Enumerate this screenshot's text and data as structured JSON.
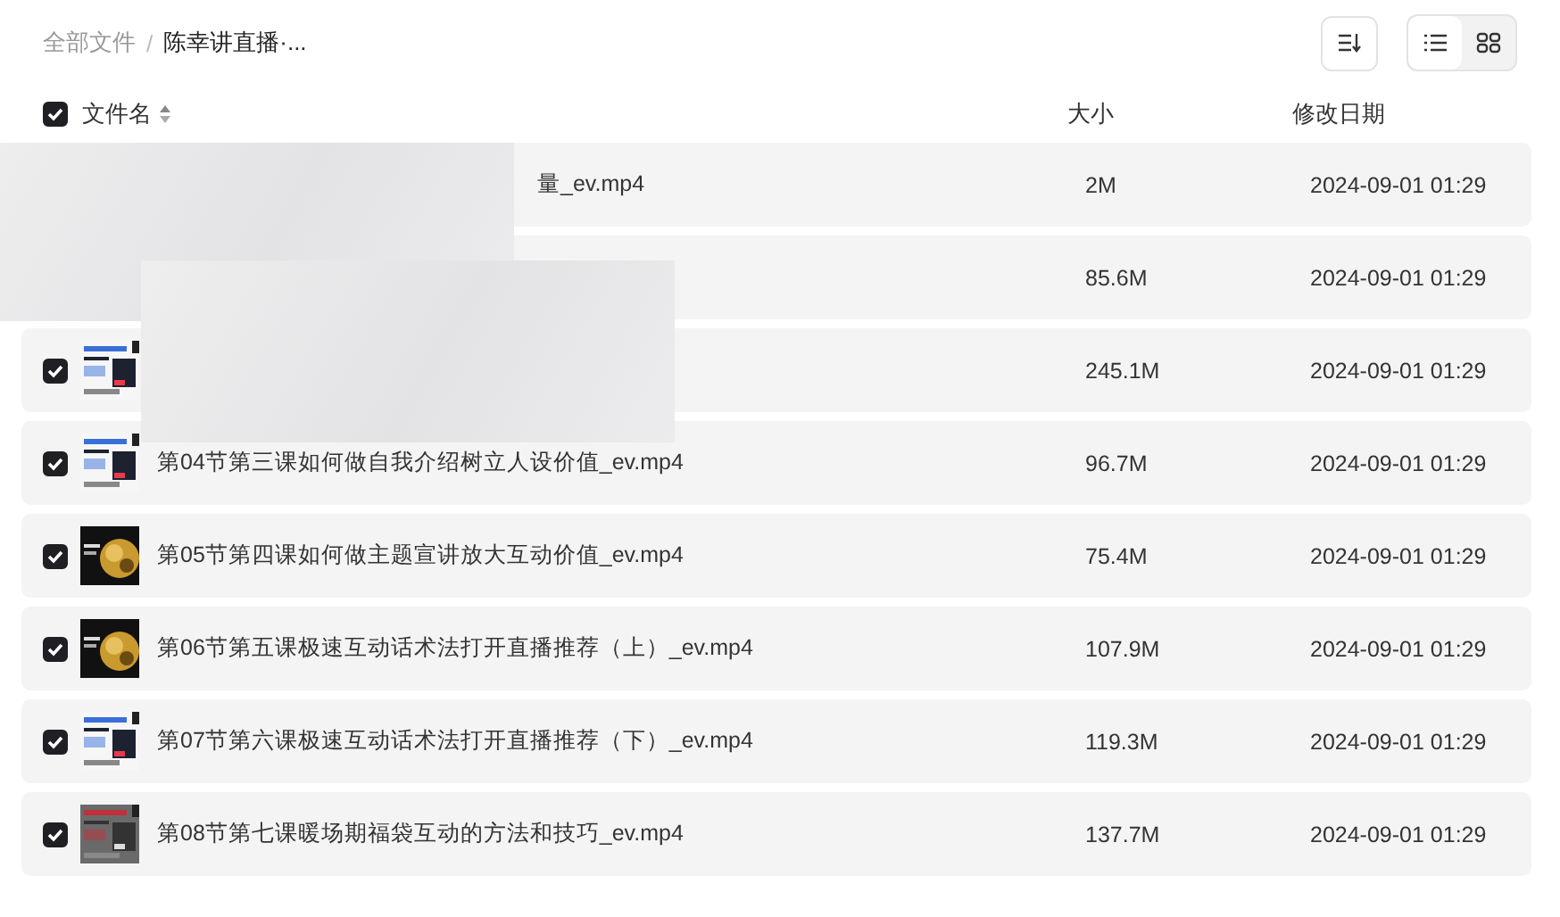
{
  "breadcrumb": [
    {
      "label": "全部文件",
      "current": false
    },
    {
      "label": "陈幸讲直播·...",
      "current": true
    }
  ],
  "breadcrumb_separator": "/",
  "toolbar": {
    "buttons": [
      {
        "kind": "sort"
      }
    ],
    "view_modes": [
      {
        "kind": "list",
        "selected": true
      },
      {
        "kind": "grid",
        "selected": false
      }
    ]
  },
  "table": {
    "select_all": {
      "checked": true
    },
    "columns": [
      {
        "label": "文件名",
        "sortable": true
      },
      {
        "label": "大小",
        "sortable": false
      },
      {
        "label": "修改日期",
        "sortable": false
      }
    ],
    "rows": [
      {
        "kind": "covered",
        "name": "量_ev.mp4",
        "size": "2M",
        "modified": "2024-09-01 01:29"
      },
      {
        "kind": "covered",
        "size": "85.6M",
        "modified": "2024-09-01 01:29"
      },
      {
        "kind": "normal",
        "checked": true,
        "size": "245.1M",
        "modified": "2024-09-01 01:29"
      },
      {
        "kind": "normal",
        "checked": true,
        "name": "第04节第三课如何做自我介绍树立人设价值_ev.mp4",
        "size": "96.7M",
        "modified": "2024-09-01 01:29"
      },
      {
        "kind": "normal",
        "checked": true,
        "name": "第05节第四课如何做主题宣讲放大互动价值_ev.mp4",
        "size": "75.4M",
        "modified": "2024-09-01 01:29"
      },
      {
        "kind": "normal",
        "checked": true,
        "name": "第06节第五课极速互动话术法打开直播推荐（上）_ev.mp4",
        "size": "107.9M",
        "modified": "2024-09-01 01:29"
      },
      {
        "kind": "normal",
        "checked": true,
        "name": "第07节第六课极速互动话术法打开直播推荐（下）_ev.mp4",
        "size": "119.3M",
        "modified": "2024-09-01 01:29"
      },
      {
        "kind": "normal",
        "checked": true,
        "name": "第08节第七课暖场期福袋互动的方法和技巧_ev.mp4",
        "size": "137.7M",
        "modified": "2024-09-01 01:29"
      }
    ]
  }
}
